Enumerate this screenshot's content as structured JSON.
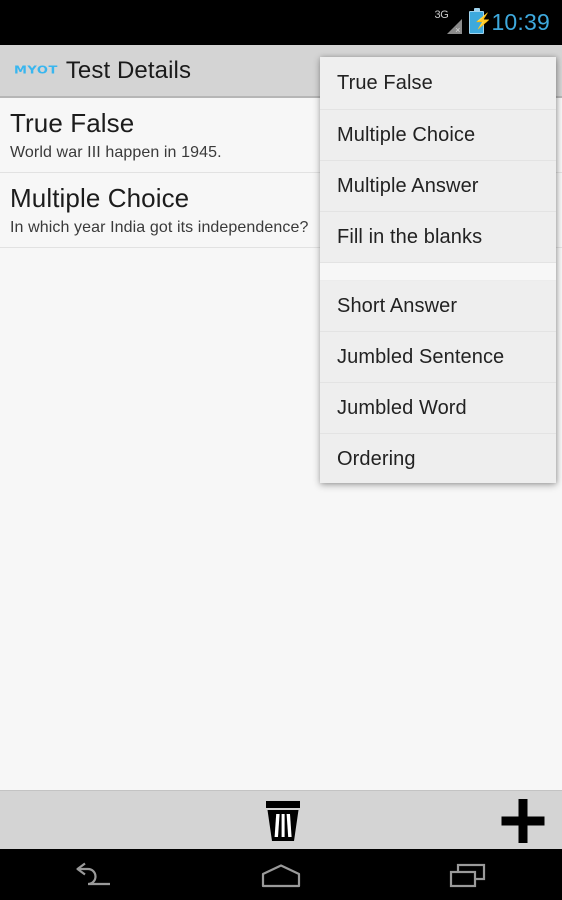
{
  "statusbar": {
    "network_label": "3G",
    "network_state": "no-service",
    "battery": "charging",
    "clock": "10:39",
    "clock_color": "#3ea9dd",
    "icons": [
      "signal-3g-icon",
      "battery-charging-icon"
    ]
  },
  "actionbar": {
    "logo_text": "MYOT",
    "logo_color": "#39b6ef",
    "title": "Test Details",
    "background": "#d4d4d4"
  },
  "content": {
    "questions": [
      {
        "type": "True False",
        "text": "World war III happen in 1945."
      },
      {
        "type": "Multiple Choice",
        "text": "In which year India got its independence?"
      }
    ]
  },
  "popup": {
    "visible": true,
    "background": "#eeeeee",
    "items": [
      {
        "label": "True False"
      },
      {
        "label": "Multiple Choice"
      },
      {
        "label": "Multiple Answer"
      },
      {
        "label": "Fill in the blanks"
      },
      {
        "label": "Short Answer"
      },
      {
        "label": "Jumbled Sentence"
      },
      {
        "label": "Jumbled Word"
      },
      {
        "label": "Ordering"
      }
    ]
  },
  "bottombar": {
    "background": "#d4d4d4",
    "buttons": [
      {
        "name": "delete-button",
        "icon": "trash-icon",
        "label": "Delete"
      },
      {
        "name": "add-button",
        "icon": "plus-icon",
        "label": "Add"
      }
    ]
  },
  "navbar": {
    "buttons": [
      {
        "name": "back-button",
        "icon": "back-arrow-icon",
        "label": "Back"
      },
      {
        "name": "home-button",
        "icon": "home-icon",
        "label": "Home"
      },
      {
        "name": "recents-button",
        "icon": "recents-icon",
        "label": "Recent apps"
      }
    ]
  }
}
